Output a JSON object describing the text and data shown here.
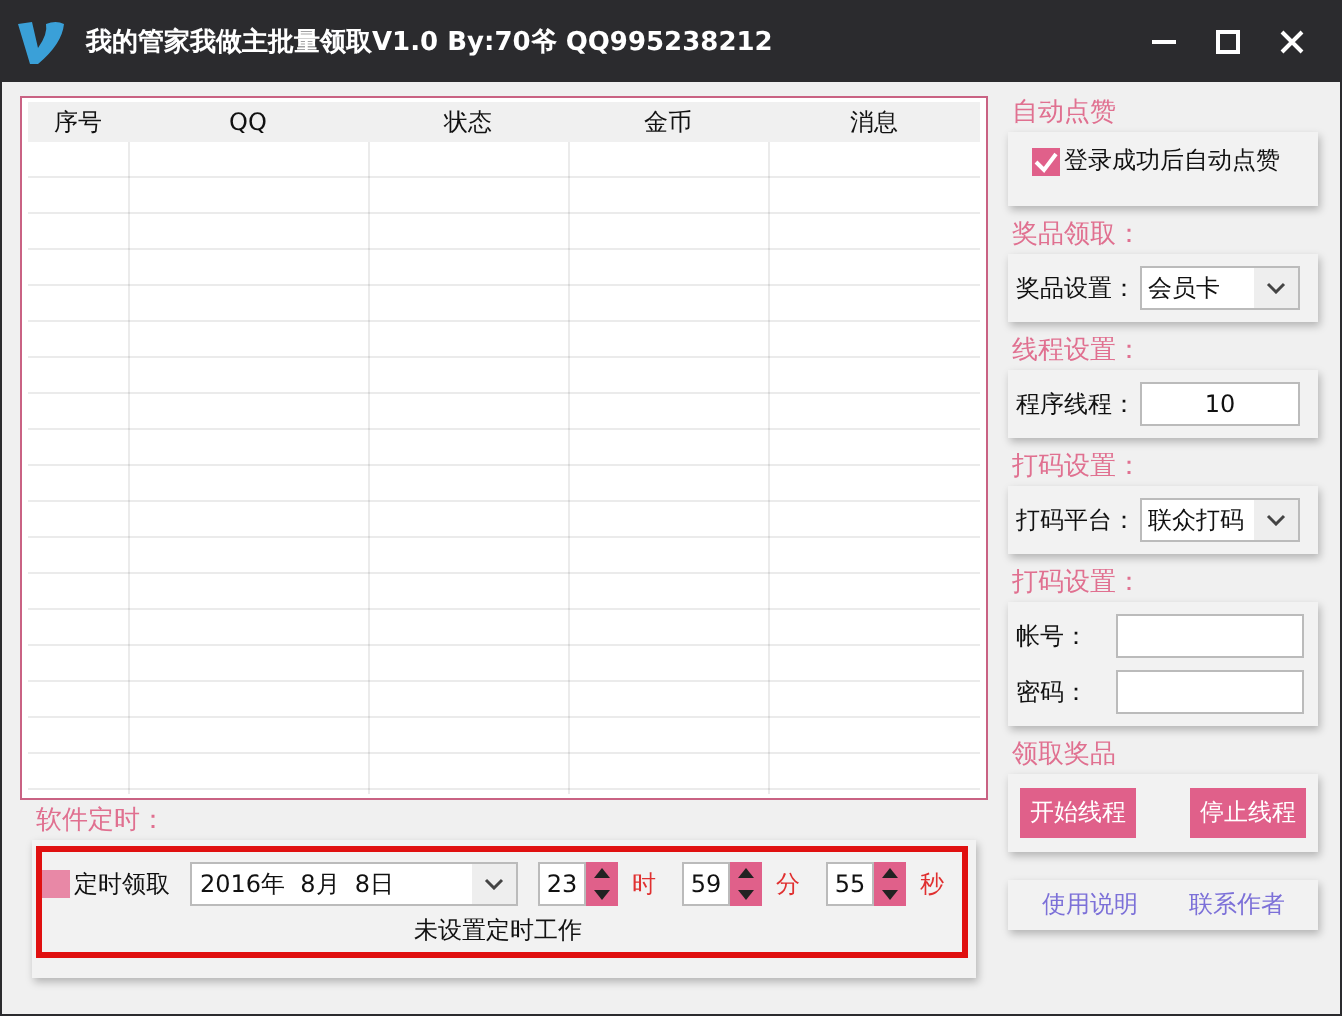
{
  "window": {
    "title": "我的管家我做主批量领取V1.0 By:70爷 QQ995238212"
  },
  "table": {
    "columns": [
      "序号",
      "QQ",
      "状态",
      "金币",
      "消息"
    ]
  },
  "auto_like": {
    "title": "自动点赞",
    "checkbox": {
      "label": "登录成功后自动点赞",
      "checked": true
    }
  },
  "prize": {
    "title": "奖品领取：",
    "label": "奖品设置：",
    "value": "会员卡"
  },
  "threads": {
    "title": "线程设置：",
    "label": "程序线程：",
    "value": "10"
  },
  "captcha": {
    "title": "打码设置：",
    "label": "打码平台：",
    "value": "联众打码"
  },
  "account": {
    "title": "打码设置：",
    "fields": [
      {
        "label": "帐号："
      },
      {
        "label": "密码："
      }
    ]
  },
  "claim": {
    "title": "领取奖品",
    "buttons": [
      "开始线程",
      "停止线程"
    ]
  },
  "links": [
    "使用说明",
    "联系作者"
  ],
  "timer": {
    "title": "软件定时：",
    "checkbox": {
      "label": "定时领取",
      "checked": false
    },
    "date": "2016年  8月  8日",
    "spins": [
      {
        "value": "23",
        "unit": "时"
      },
      {
        "value": "59",
        "unit": "分"
      },
      {
        "value": "55",
        "unit": "秒"
      }
    ],
    "status": "未设置定时工作"
  }
}
